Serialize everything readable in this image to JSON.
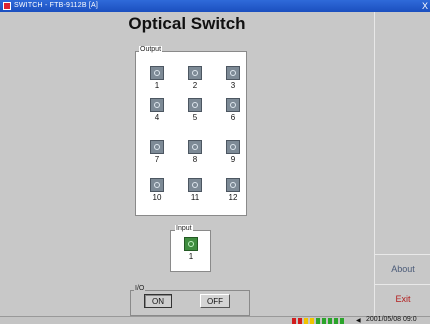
{
  "window": {
    "title": "SWITCH - FTB-9112B [A]",
    "close_glyph": "X"
  },
  "page_title": "Optical Switch",
  "output": {
    "legend": "Output",
    "ports": [
      "1",
      "2",
      "3",
      "4",
      "5",
      "6",
      "7",
      "8",
      "9",
      "10",
      "11",
      "12"
    ]
  },
  "input": {
    "legend": "Input",
    "ports": [
      "1"
    ]
  },
  "io": {
    "legend": "I/O",
    "on_label": "ON",
    "off_label": "OFF"
  },
  "side": {
    "about_label": "About",
    "exit_label": "Exit"
  },
  "status": {
    "datetime": "2001/05/08 09:0",
    "led_colors": [
      "#d21c1c",
      "#d21c1c",
      "#f0c400",
      "#f0c400",
      "#2aa52a",
      "#2aa52a",
      "#2aa52a",
      "#2aa52a",
      "#2aa52a"
    ],
    "icon": "speaker-icon"
  },
  "colors": {
    "accent": "#1b4fbf",
    "exit": "#b21d1d",
    "about": "#4a5a78"
  }
}
